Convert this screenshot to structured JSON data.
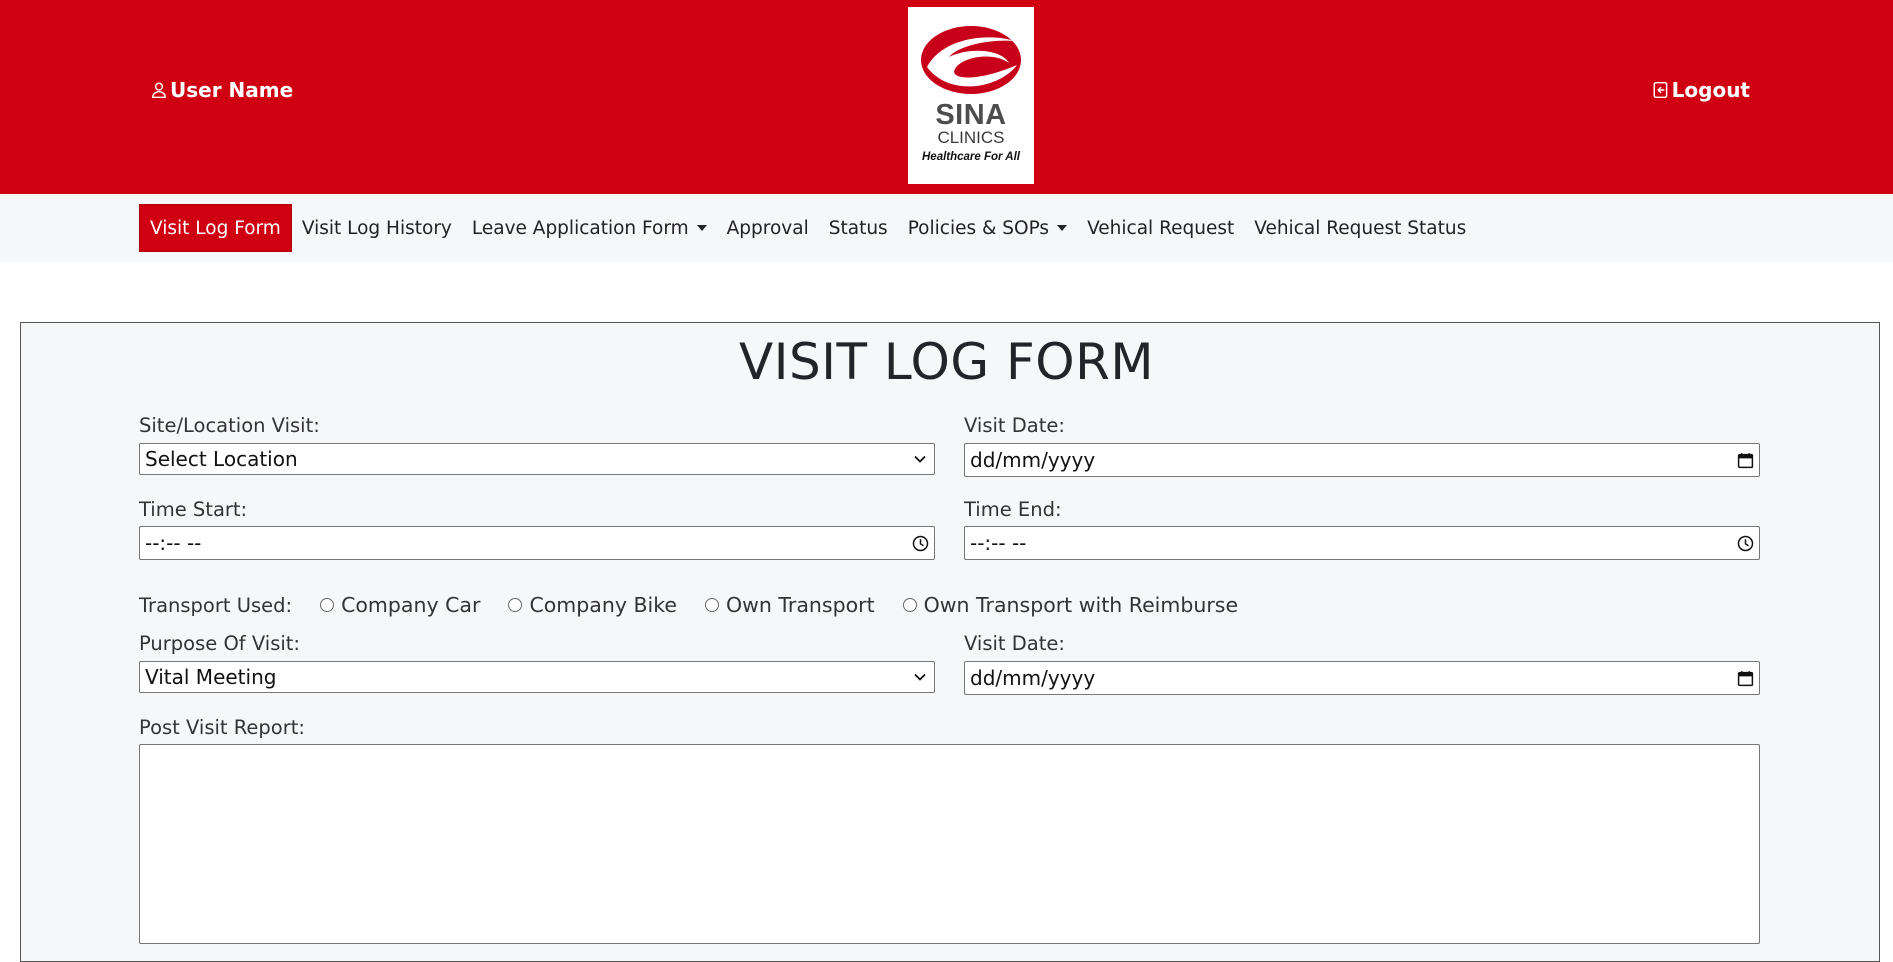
{
  "header": {
    "user_label": "User Name",
    "logout_label": "Logout",
    "logo": {
      "brand": "SINA",
      "subbrand": "CLINICS",
      "tagline": "Healthcare For All"
    },
    "colors": {
      "primary": "#cf0011",
      "logo_swoosh": "#c8001a"
    }
  },
  "nav": {
    "items": [
      {
        "label": "Visit Log Form",
        "active": true
      },
      {
        "label": "Visit Log History"
      },
      {
        "label": "Leave Application Form",
        "dropdown": true
      },
      {
        "label": "Approval"
      },
      {
        "label": "Status"
      },
      {
        "label": "Policies & SOPs",
        "dropdown": true
      },
      {
        "label": "Vehical Request"
      },
      {
        "label": "Vehical Request Status"
      }
    ]
  },
  "form": {
    "title": "VISIT LOG FORM",
    "site": {
      "label": "Site/Location Visit:",
      "value": "Select Location"
    },
    "visit_date": {
      "label": "Visit Date:",
      "value": "dd/mm/yyyy"
    },
    "time_start": {
      "label": "Time Start:",
      "value": "--:-- --"
    },
    "time_end": {
      "label": "Time End:",
      "value": "--:-- --"
    },
    "transport": {
      "label": "Transport Used:",
      "options": [
        "Company Car",
        "Company Bike",
        "Own Transport",
        "Own Transport with Reimburse"
      ]
    },
    "purpose": {
      "label": "Purpose Of Visit:",
      "value": "Vital Meeting"
    },
    "visit_date_2": {
      "label": "Visit Date:",
      "value": "dd/mm/yyyy"
    },
    "report": {
      "label": "Post Visit Report:",
      "value": ""
    }
  }
}
